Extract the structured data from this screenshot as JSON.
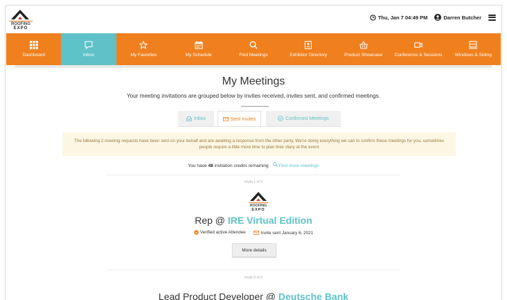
{
  "header": {
    "logo_text": "ROOFING EXPO",
    "datetime": "Thu, Jan 7 04:49 PM",
    "user_name": "Darren Butcher"
  },
  "nav": {
    "items": [
      {
        "label": "Dashboard",
        "icon": "grid-icon"
      },
      {
        "label": "Inbox",
        "icon": "message-icon"
      },
      {
        "label": "My Favorites",
        "icon": "star-icon"
      },
      {
        "label": "My Schedule",
        "icon": "calendar-icon"
      },
      {
        "label": "Find Meetings",
        "icon": "search-icon"
      },
      {
        "label": "Exhibitor Directory",
        "icon": "directory-icon"
      },
      {
        "label": "Product Showcase",
        "icon": "basket-icon"
      },
      {
        "label": "Conference & Sessions",
        "icon": "video-icon"
      },
      {
        "label": "Windows & Siding",
        "icon": "window-icon"
      }
    ],
    "active_index": 1
  },
  "page": {
    "title": "My Meetings",
    "subtitle": "Your meeting invitations are grouped below by invites received, invites sent, and confirmed meetings."
  },
  "tabs": {
    "inbox": "Inbox",
    "sent": "Sent Invites",
    "confirmed": "Confirmed Meetings",
    "active": "sent"
  },
  "notice": {
    "line1": "The following 2 meeting requests have been sent on your behalf and are awaiting a response from the other party. We're doing everything we can to confirm these meetings for you, sometimes",
    "line2": "people require a little more time to plan their diary at the event"
  },
  "credits": {
    "prefix": "You have",
    "count": "48",
    "suffix": "invitation credits remaining",
    "find_link": "Find more meetings"
  },
  "invites": [
    {
      "counter": "Invite 1 of 2",
      "role": "Rep @",
      "company": "IRE Virtual Edition",
      "verified": "Verified active Attendee",
      "sent": "Invite sent January 6, 2021",
      "more": "More details"
    },
    {
      "counter": "Invite 2 of 2",
      "role": "Lead Product Developer @",
      "company": "Deutsche Bank"
    }
  ],
  "colors": {
    "nav_orange": "#f0801e",
    "accent_teal": "#5ec2c8",
    "notice_bg": "#fcf6e3",
    "notice_text": "#9b7a3e"
  }
}
